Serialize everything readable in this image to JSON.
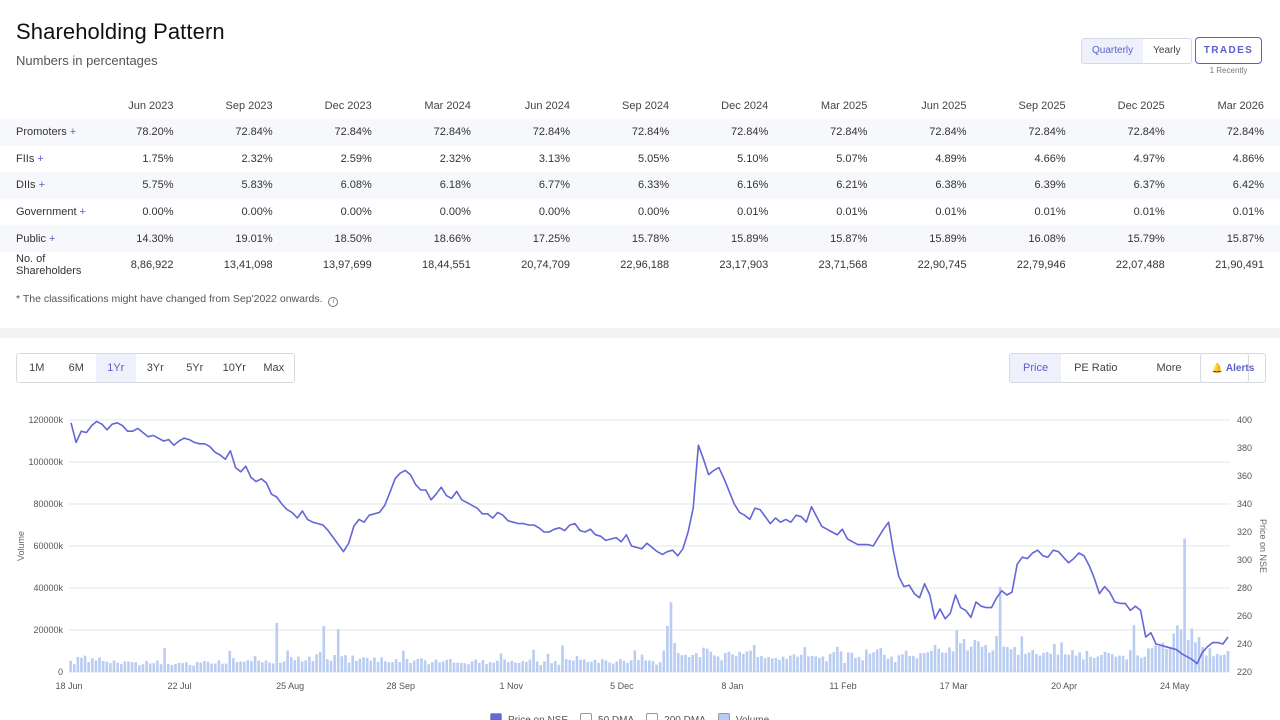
{
  "shareholding": {
    "title": "Shareholding Pattern",
    "subtitle": "Numbers in percentages",
    "toggle": {
      "quarterly": "Quarterly",
      "yearly": "Yearly"
    },
    "trades": {
      "label": "TRADES",
      "sub": "1 Recently"
    },
    "columns": [
      "Jun 2023",
      "Sep 2023",
      "Dec 2023",
      "Mar 2024",
      "Jun 2024",
      "Sep 2024",
      "Dec 2024",
      "Mar 2025",
      "Jun 2025",
      "Sep 2025",
      "Dec 2025",
      "Mar 2026"
    ],
    "rows": [
      {
        "label": "Promoters",
        "expand": "+",
        "values": [
          "78.20%",
          "72.84%",
          "72.84%",
          "72.84%",
          "72.84%",
          "72.84%",
          "72.84%",
          "72.84%",
          "72.84%",
          "72.84%",
          "72.84%",
          "72.84%"
        ]
      },
      {
        "label": "FIIs",
        "expand": "+",
        "values": [
          "1.75%",
          "2.32%",
          "2.59%",
          "2.32%",
          "3.13%",
          "5.05%",
          "5.10%",
          "5.07%",
          "4.89%",
          "4.66%",
          "4.97%",
          "4.86%"
        ]
      },
      {
        "label": "DIIs",
        "expand": "+",
        "values": [
          "5.75%",
          "5.83%",
          "6.08%",
          "6.18%",
          "6.77%",
          "6.33%",
          "6.16%",
          "6.21%",
          "6.38%",
          "6.39%",
          "6.37%",
          "6.42%"
        ]
      },
      {
        "label": "Government",
        "expand": "+",
        "values": [
          "0.00%",
          "0.00%",
          "0.00%",
          "0.00%",
          "0.00%",
          "0.00%",
          "0.01%",
          "0.01%",
          "0.01%",
          "0.01%",
          "0.01%",
          "0.01%"
        ]
      },
      {
        "label": "Public",
        "expand": "+",
        "values": [
          "14.30%",
          "19.01%",
          "18.50%",
          "18.66%",
          "17.25%",
          "15.78%",
          "15.89%",
          "15.87%",
          "15.89%",
          "16.08%",
          "15.79%",
          "15.87%"
        ]
      },
      {
        "label": "No. of Shareholders",
        "expand": "",
        "values": [
          "8,86,922",
          "13,41,098",
          "13,97,699",
          "18,44,551",
          "20,74,709",
          "22,96,188",
          "23,17,903",
          "23,71,568",
          "22,90,745",
          "22,79,946",
          "22,07,488",
          "21,90,491"
        ]
      }
    ],
    "footnote": "* The classifications might have changed from Sep'2022 onwards.",
    "info_icon": "i"
  },
  "controls": {
    "periods": [
      "1M",
      "6M",
      "1Yr",
      "3Yr",
      "5Yr",
      "10Yr",
      "Max"
    ],
    "active_period": "1Yr",
    "price_tab": "Price",
    "pe_tab": "PE Ratio",
    "more_tab": "More",
    "more_icon": "chevron-down-icon",
    "alerts": "Alerts",
    "alerts_icon": "bell-icon"
  },
  "chart_data": {
    "type": "line",
    "x_ticks": [
      "18 Jun",
      "22 Jul",
      "25 Aug",
      "28 Sep",
      "1 Nov",
      "5 Dec",
      "8 Jan",
      "11 Feb",
      "17 Mar",
      "20 Apr",
      "24 May"
    ],
    "ylabel_left": "Volume",
    "ylabel_right": "Price on NSE",
    "yticks_left": [
      "0",
      "20000k",
      "40000k",
      "60000k",
      "80000k",
      "100000k",
      "120000k"
    ],
    "yticks_right": [
      "220",
      "240",
      "260",
      "280",
      "300",
      "320",
      "340",
      "360",
      "380",
      "400"
    ],
    "ylim_left": [
      0,
      120000000
    ],
    "ylim_right": [
      220,
      400
    ],
    "grid": true,
    "legend_position": "bottom",
    "series": [
      {
        "name": "Price on NSE",
        "color": "#6466d6",
        "values": [
          398,
          384,
          392,
          391,
          396,
          399,
          397,
          393,
          397,
          398,
          396,
          392,
          392,
          394,
          391,
          388,
          389,
          387,
          385,
          386,
          382,
          385,
          387,
          386,
          384,
          383,
          383,
          381,
          377,
          375,
          372,
          378,
          366,
          363,
          367,
          359,
          356,
          358,
          355,
          347,
          345,
          340,
          336,
          334,
          330,
          335,
          329,
          327,
          326,
          325,
          321,
          316,
          311,
          306,
          312,
          324,
          329,
          327,
          332,
          333,
          334,
          339,
          348,
          358,
          362,
          364,
          361,
          354,
          350,
          350,
          343,
          347,
          352,
          346,
          344,
          349,
          343,
          341,
          339,
          337,
          333,
          333,
          330,
          334,
          332,
          328,
          327,
          326,
          326,
          325,
          325,
          323,
          320,
          320,
          322,
          323,
          321,
          325,
          326,
          321,
          320,
          322,
          318,
          317,
          314,
          315,
          316,
          313,
          318,
          310,
          309,
          308,
          312,
          309,
          306,
          304,
          306,
          307,
          303,
          308,
          320,
          337,
          382,
          372,
          361,
          364,
          366,
          358,
          349,
          340,
          334,
          332,
          329,
          337,
          336,
          331,
          326,
          330,
          327,
          329,
          327,
          332,
          331,
          327,
          338,
          331,
          324,
          322,
          320,
          318,
          322,
          315,
          313,
          311,
          311,
          311,
          310,
          316,
          322,
          327,
          305,
          288,
          281,
          282,
          276,
          273,
          283,
          275,
          258,
          265,
          258,
          262,
          275,
          266,
          264,
          259,
          270,
          267,
          266,
          266,
          273,
          278,
          275,
          277,
          297,
          302,
          301,
          305,
          307,
          303,
          302,
          307,
          306,
          302,
          298,
          301,
          305,
          303,
          296,
          287,
          276,
          281,
          277,
          270,
          269,
          269,
          264,
          267,
          264,
          245,
          248,
          240,
          239,
          238,
          237,
          236,
          233,
          231,
          229,
          226,
          234,
          238,
          241,
          241,
          240,
          245
        ]
      },
      {
        "name": "Volume",
        "color": "#b9cdf2",
        "values": [
          5400000,
          3800000,
          7200000,
          6800000,
          7800000,
          4700000,
          6500000,
          5500000,
          6900000,
          5200000,
          4900000,
          4200000,
          5500000,
          4400000,
          3800000,
          5000000,
          5000000,
          4700000,
          4700000,
          3200000,
          3700000,
          5300000,
          4100000,
          4200000,
          5400000,
          3700000,
          11500000,
          3800000,
          3300000,
          3900000,
          4400000,
          4200000,
          4700000,
          3400000,
          3100000,
          4800000,
          4500000,
          5200000,
          4800000,
          4000000,
          4100000,
          5500000,
          3900000,
          4000000,
          10100000,
          6600000,
          4700000,
          5000000,
          4900000,
          5600000,
          5200000,
          7600000,
          5400000,
          4600000,
          5500000,
          4500000,
          4100000,
          23400000,
          4400000,
          5000000,
          10200000,
          7100000,
          5600000,
          7300000,
          5000000,
          5500000,
          7300000,
          5200000,
          8400000,
          9600000,
          21800000,
          6100000,
          5400000,
          8100000,
          20400000,
          7500000,
          8000000,
          4500000,
          7800000,
          5300000,
          6300000,
          7000000,
          6700000,
          5400000,
          6900000,
          4800000,
          7000000,
          5100000,
          4600000,
          4700000,
          6100000,
          4700000,
          10200000,
          6200000,
          4300000,
          5400000,
          6200000,
          6500000,
          5600000,
          3700000,
          4700000,
          5900000,
          4600000,
          5000000,
          5800000,
          6200000,
          4500000,
          4400000,
          4300000,
          4200000,
          3700000,
          5100000,
          6000000,
          4300000,
          5700000,
          3800000,
          4700000,
          4400000,
          5400000,
          8800000,
          6000000,
          4700000,
          5300000,
          4500000,
          4300000,
          5200000,
          4800000,
          5900000,
          10600000,
          5000000,
          3300000,
          5100000,
          8700000,
          4200000,
          5200000,
          3500000,
          12600000,
          6100000,
          5700000,
          5400000,
          7700000,
          5800000,
          5900000,
          4800000,
          4900000,
          5800000,
          4300000,
          6100000,
          5500000,
          4500000,
          4000000,
          5000000,
          6200000,
          5300000,
          4400000,
          5600000,
          10300000,
          5700000,
          8300000,
          5500000,
          5500000,
          5100000,
          3500000,
          4700000,
          10200000,
          21900000,
          33200000,
          13800000,
          9000000,
          8000000,
          8200000,
          7100000,
          8100000,
          9000000,
          7100000,
          11600000,
          11100000,
          9700000,
          7900000,
          7400000,
          5600000,
          9000000,
          9600000,
          8400000,
          7500000,
          9600000,
          8700000,
          9800000,
          10200000,
          12800000,
          7100000,
          7700000,
          6600000,
          7100000,
          6500000,
          6700000,
          5800000,
          7300000,
          6200000,
          7800000,
          8400000,
          7300000,
          8200000,
          11800000,
          7400000,
          7700000,
          7400000,
          6700000,
          7400000,
          5100000,
          8700000,
          9500000,
          12000000,
          9800000,
          4300000,
          9300000,
          9200000,
          6700000,
          7200000,
          5600000,
          10700000,
          8700000,
          9400000,
          10700000,
          11400000,
          8200000,
          6300000,
          7300000,
          4700000,
          8000000,
          8400000,
          10200000,
          7600000,
          7700000,
          6500000,
          9000000,
          9000000,
          9400000,
          10100000,
          12900000,
          11100000,
          9300000,
          9200000,
          11700000,
          9800000,
          19900000,
          13700000,
          15700000,
          10200000,
          12100000,
          15300000,
          14600000,
          12000000,
          12800000,
          9200000,
          10300000,
          17100000,
          40500000,
          12100000,
          11900000,
          10800000,
          11900000,
          8200000,
          17000000,
          8600000,
          9300000,
          10500000,
          8500000,
          7800000,
          9100000,
          9500000,
          8700000,
          13400000,
          8300000,
          14100000,
          8400000,
          8200000,
          10400000,
          7800000,
          9300000,
          6000000,
          10100000,
          7300000,
          6700000,
          7400000,
          8100000,
          9600000,
          9000000,
          8500000,
          7300000,
          7800000,
          7700000,
          6000000,
          10400000,
          22300000,
          7900000,
          6800000,
          7300000,
          11200000,
          11300000,
          12700000,
          12300000,
          13900000,
          11000000,
          11200000,
          18400000,
          22200000,
          20300000,
          63600000,
          15200000,
          20700000,
          14100000,
          16600000,
          11900000,
          7900000,
          11300000,
          7500000,
          8600000,
          8000000,
          8300000,
          10000000
        ]
      }
    ]
  },
  "legend": [
    {
      "label": "Price on NSE",
      "color": "#6466d6"
    },
    {
      "label": "50 DMA",
      "color": "#ffffff"
    },
    {
      "label": "200 DMA",
      "color": "#ffffff"
    },
    {
      "label": "Volume",
      "color": "#b9cdf2"
    }
  ]
}
